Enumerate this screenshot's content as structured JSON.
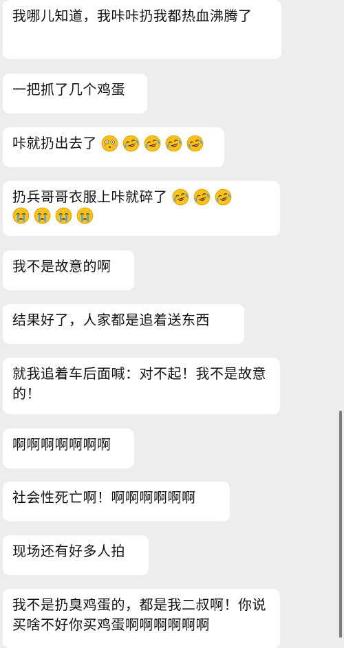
{
  "messages": [
    {
      "text": "我哪儿知道，我咔咔扔我都热血沸腾了"
    },
    {
      "text": "一把抓了几个鸡蛋"
    },
    {
      "text": "咔就扔出去了",
      "emojis": [
        "flushed-face",
        "crying-laughing-face",
        "crying-laughing-face",
        "crying-laughing-face",
        "crying-laughing-face"
      ]
    },
    {
      "text": "扔兵哥哥衣服上咔就碎了",
      "emojis": [
        "crying-laughing-face",
        "crying-laughing-face",
        "crying-laughing-face"
      ],
      "emojis_line2": [
        "loudly-crying-face",
        "loudly-crying-face",
        "loudly-crying-face",
        "loudly-crying-face"
      ]
    },
    {
      "text": "我不是故意的啊"
    },
    {
      "text": "结果好了，人家都是追着送东西"
    },
    {
      "text": "就我追着车后面喊：对不起！我不是故意的！"
    },
    {
      "text": "啊啊啊啊啊啊啊"
    },
    {
      "text": "社会性死亡啊！啊啊啊啊啊啊"
    },
    {
      "text": "现场还有好多人拍"
    },
    {
      "text": "我不是扔臭鸡蛋的，都是我二叔啊！你说买啥不好你买鸡蛋啊啊啊啊啊啊"
    }
  ],
  "colors": {
    "background": "#ededed",
    "bubble": "#ffffff",
    "text": "#111111",
    "emoji_yellow": "#f7c21b",
    "tear_blue": "#4aa3e8"
  }
}
